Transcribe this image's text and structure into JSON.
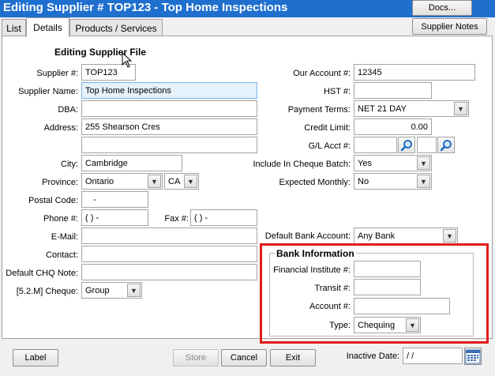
{
  "window": {
    "title": "Editing Supplier # TOP123 - Top Home Inspections",
    "docs_button": "Docs..."
  },
  "tabs": [
    {
      "label": "List",
      "active": false
    },
    {
      "label": "Details",
      "active": true
    },
    {
      "label": "Products / Services",
      "active": false
    }
  ],
  "supplier_notes_button": "Supplier Notes",
  "form": {
    "heading": "Editing Supplier File",
    "supplier_no": {
      "label": "Supplier #:",
      "value": "TOP123"
    },
    "supplier_name": {
      "label": "Supplier Name:",
      "value": "Top Home Inspections"
    },
    "dba": {
      "label": "DBA:",
      "value": ""
    },
    "address": {
      "label": "Address:",
      "line1": "255 Shearson Cres",
      "line2": ""
    },
    "city": {
      "label": "City:",
      "value": "Cambridge"
    },
    "province": {
      "label": "Province:",
      "value": "Ontario",
      "country": "CA"
    },
    "postal_code": {
      "label": "Postal Code:",
      "value": "-"
    },
    "phone": {
      "label": "Phone #:",
      "value": "(  )  -"
    },
    "fax": {
      "label": "Fax #:",
      "value": "(  )  -"
    },
    "email": {
      "label": "E-Mail:",
      "value": ""
    },
    "contact": {
      "label": "Contact:",
      "value": ""
    },
    "default_chq_note": {
      "label": "Default CHQ Note:",
      "value": ""
    },
    "cheque": {
      "label": "[5.2.M] Cheque:",
      "value": "Group"
    },
    "our_account": {
      "label": "Our Account #:",
      "value": "12345"
    },
    "hst": {
      "label": "HST #:",
      "value": ""
    },
    "payment_terms": {
      "label": "Payment Terms:",
      "value": "NET 21 DAY"
    },
    "credit_limit": {
      "label": "Credit Limit:",
      "value": "0.00"
    },
    "gl_acct": {
      "label": "G/L Acct #:",
      "value": "",
      "value2": ""
    },
    "include_cheque_batch": {
      "label": "Include In Cheque Batch:",
      "value": "Yes"
    },
    "expected_monthly": {
      "label": "Expected Monthly:",
      "value": "No"
    },
    "default_bank_account": {
      "label": "Default Bank Account:",
      "value": "Any Bank"
    },
    "inactive_date": {
      "label": "Inactive Date:",
      "value": " / /"
    }
  },
  "bank_information": {
    "title": "Bank Information",
    "financial_institute": {
      "label": "Financial Institute #:",
      "value": ""
    },
    "transit": {
      "label": "Transit #:",
      "value": ""
    },
    "account": {
      "label": "Account #:",
      "value": ""
    },
    "type": {
      "label": "Type:",
      "value": "Chequing"
    }
  },
  "buttons": {
    "label": "Label",
    "store": "Store",
    "cancel": "Cancel",
    "exit": "Exit"
  }
}
